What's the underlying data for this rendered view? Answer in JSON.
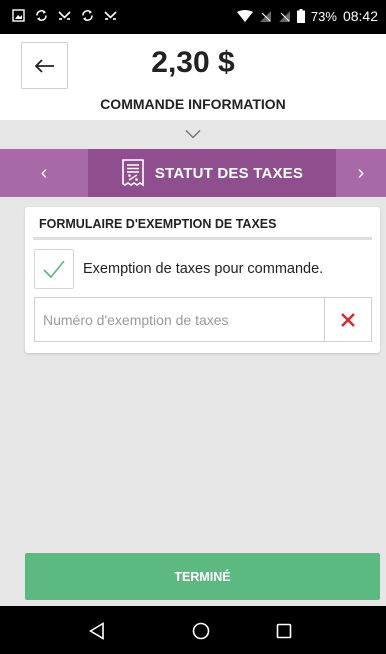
{
  "status_bar": {
    "battery": "73%",
    "time": "08:42"
  },
  "header": {
    "amount": "2,30 $",
    "subtitle": "COMMANDE INFORMATION"
  },
  "section_nav": {
    "prev_label": "‹",
    "next_label": "›",
    "title": "STATUT DES TAXES"
  },
  "form": {
    "title": "FORMULAIRE D'EXEMPTION DE TAXES",
    "checkbox_label": "Exemption de taxes pour commande.",
    "checkbox_checked": true,
    "input_placeholder": "Numéro d'exemption de taxes",
    "input_value": ""
  },
  "done_button": {
    "label": "TERMINÉ"
  },
  "colors": {
    "accent_purple": "#a869a8",
    "accent_purple_dark": "#8f4f8f",
    "done_green": "#5cba80",
    "check_green": "#5cba80",
    "clear_red": "#d9262c"
  }
}
